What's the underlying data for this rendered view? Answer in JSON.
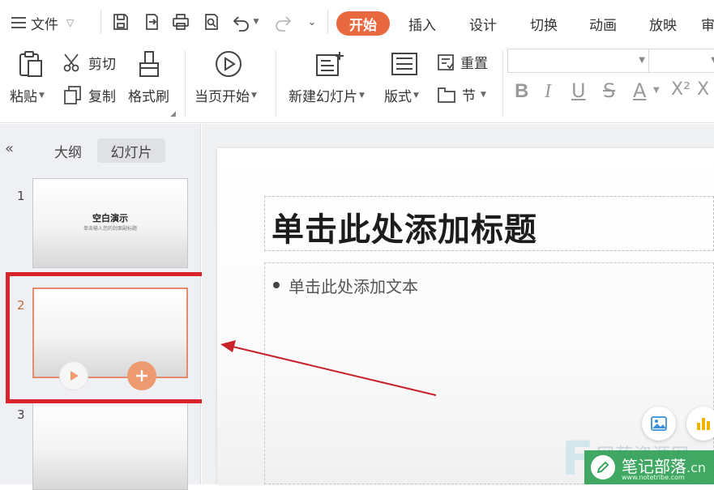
{
  "menu": {
    "file_label": "文件",
    "tabs": [
      "开始",
      "插入",
      "设计",
      "切换",
      "动画",
      "放映",
      "审"
    ],
    "active_tab": "开始"
  },
  "ribbon": {
    "paste": "粘贴",
    "cut": "剪切",
    "copy": "复制",
    "format_painter": "格式刷",
    "play_from_current": "当页开始",
    "new_slide": "新建幻灯片",
    "layout": "版式",
    "reset": "重置",
    "section": "节",
    "superscript": "X²"
  },
  "panel": {
    "tabs": [
      "大纲",
      "幻灯片"
    ],
    "active_tab": "幻灯片",
    "slides": [
      {
        "number": "1",
        "title": "空白演示",
        "subtitle": "单击输入您的封面副标题"
      },
      {
        "number": "2"
      },
      {
        "number": "3"
      }
    ]
  },
  "slide": {
    "title_placeholder": "单击此处添加标题",
    "body_placeholder": "单击此处添加文本"
  },
  "watermark": {
    "line1": "网药资源网",
    "brand": "笔记部落",
    "domain": ".cn",
    "url": "www.notetribe.com"
  },
  "colors": {
    "accent": "#e8683f",
    "highlight_box": "#d8242a",
    "arrow": "#c9212a"
  },
  "icons": [
    "hamburger-menu-icon",
    "save-icon",
    "export-icon",
    "print-icon",
    "print-preview-icon",
    "undo-icon",
    "redo-icon",
    "more-icon",
    "paste-icon",
    "scissors-icon",
    "copy-icon",
    "brush-icon",
    "play-icon",
    "new-slide-icon",
    "layout-icon",
    "reset-icon",
    "section-icon",
    "bold-icon",
    "italic-icon",
    "underline-icon",
    "strikethrough-icon",
    "font-color-icon",
    "image-icon",
    "chart-icon",
    "plus-icon"
  ]
}
